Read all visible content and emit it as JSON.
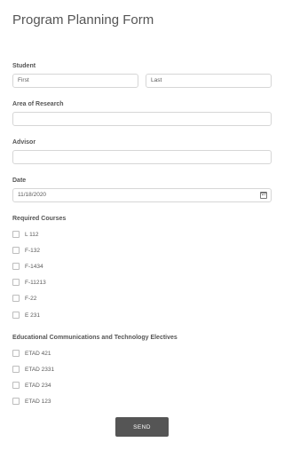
{
  "form": {
    "title": "Program Planning Form",
    "student": {
      "label": "Student",
      "first_placeholder": "First",
      "last_placeholder": "Last"
    },
    "research": {
      "label": "Area of Research",
      "value": ""
    },
    "advisor": {
      "label": "Advisor",
      "value": ""
    },
    "date": {
      "label": "Date",
      "value": "11/18/2020",
      "icon": "calendar-icon"
    },
    "required_courses": {
      "label": "Required Courses",
      "options": [
        "L 112",
        "F-132",
        "F-1434",
        "F-11213",
        "F-22",
        "E 231"
      ]
    },
    "electives": {
      "label": "Educational Communications and Technology Electives",
      "options": [
        "ETAD 421",
        "ETAD 2331",
        "ETAD 234",
        "ETAD 123"
      ]
    },
    "send_label": "SEND"
  }
}
